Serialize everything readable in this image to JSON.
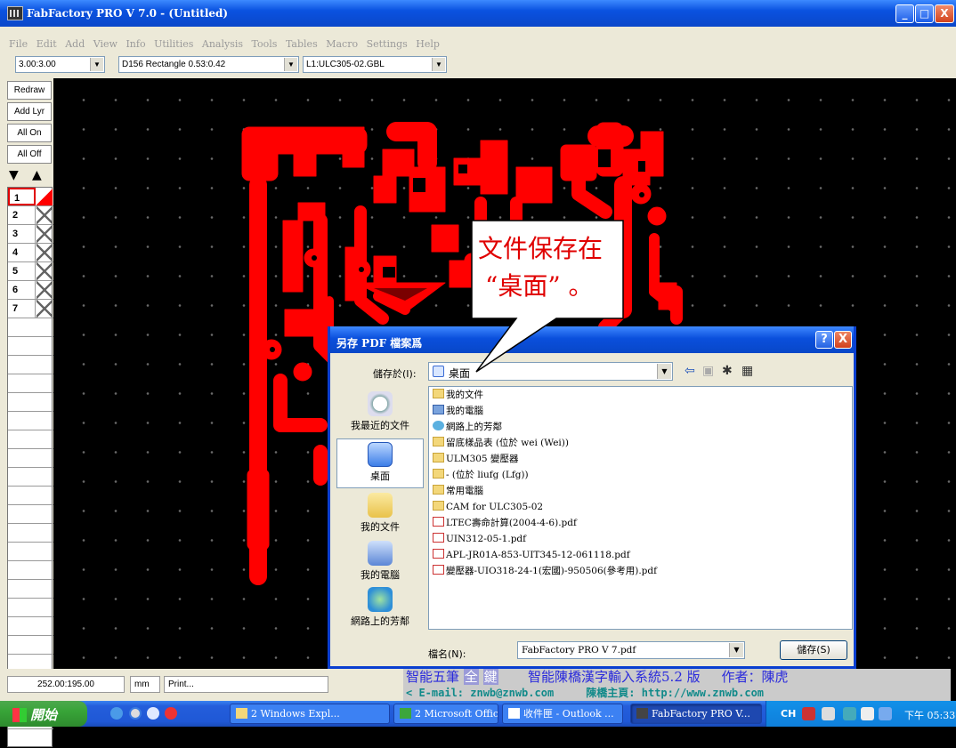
{
  "window": {
    "title": "FabFactory PRO V 7.0 - (Untitled)",
    "minimize": "_",
    "maximize": "□",
    "close": "X"
  },
  "menu": [
    "File",
    "Edit",
    "Add",
    "View",
    "Info",
    "Utilities",
    "Analysis",
    "Tools",
    "Tables",
    "Macro",
    "Settings",
    "Help"
  ],
  "toolbar": {
    "zoom": "3.00:3.00",
    "aperture": "D156  Rectangle 0.53:0.42",
    "layer": "L1:ULC305-02.GBL"
  },
  "left_buttons": {
    "redraw": "Redraw",
    "add_layer": "Add Lyr",
    "all_on": "All On",
    "all_off": "All Off",
    "down": "▼",
    "up": "▲"
  },
  "layers": [
    "1",
    "2",
    "3",
    "4",
    "5",
    "6",
    "7"
  ],
  "dialog": {
    "title": "另存 PDF 檔案爲",
    "help": "?",
    "close": "X",
    "save_in_label": "儲存於(I):",
    "save_in_value": "桌面",
    "places": [
      "我最近的文件",
      "桌面",
      "我的文件",
      "我的電腦",
      "網路上的芳鄰"
    ],
    "files": [
      {
        "name": "我的文件",
        "icon": "folder"
      },
      {
        "name": "我的電腦",
        "icon": "computer"
      },
      {
        "name": "網路上的芳鄰",
        "icon": "network"
      },
      {
        "name": "留底樣品表 (位於 wei (Wei))",
        "icon": "network-folder"
      },
      {
        "name": "ULM305 變壓器",
        "icon": "folder"
      },
      {
        "name": "- (位於 liufg (Lfg))",
        "icon": "folder"
      },
      {
        "name": "常用電腦",
        "icon": "folder"
      },
      {
        "name": "CAM for ULC305-02",
        "icon": "folder"
      },
      {
        "name": "LTEC壽命計算(2004-4-6).pdf",
        "icon": "pdf"
      },
      {
        "name": "UIN312-05-1.pdf",
        "icon": "pdf"
      },
      {
        "name": "APL-JR01A-853-UIT345-12-061118.pdf",
        "icon": "pdf"
      },
      {
        "name": "變壓器-UIO318-24-1(宏國)-950506(參考用).pdf",
        "icon": "pdf"
      }
    ],
    "filename_label": "檔名(N):",
    "filename_value": "FabFactory PRO V 7.pdf",
    "save_button": "儲存(S)"
  },
  "callout": {
    "line1": "文件保存在",
    "line2": "“桌面”  。"
  },
  "statusbar": {
    "coords": "252.00:195.00",
    "units": "mm",
    "message": "Print..."
  },
  "ime": {
    "mode1": "智能五筆",
    "mode2": "全",
    "mode3": "鍵",
    "system": "智能陳橋漢字輸入系統5.2 版",
    "author": "作者：陳虎",
    "email": "E-mail: znwb@znwb.com",
    "homepage": "陳橋主頁: http://www.znwb.com"
  },
  "taskbar": {
    "start": "開始",
    "tasks": [
      "2 Windows Expl...",
      "2 Microsoft Offic...",
      "收件匣 - Outlook ...",
      "FabFactory PRO V..."
    ],
    "lang": "CH",
    "clock": "下午 05:33"
  },
  "colors": {
    "pcb_copper": "#ff0000",
    "canvas_bg": "#000000",
    "xp_blue": "#0a52e0",
    "callout_text": "#e00000"
  }
}
